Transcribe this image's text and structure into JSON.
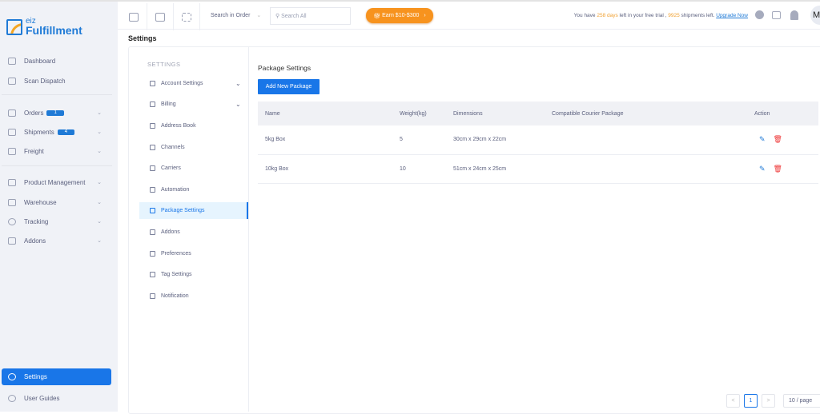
{
  "brand": {
    "small": "eiz",
    "name": "Fulfillment"
  },
  "sidebar": {
    "items": [
      {
        "label": "Dashboard"
      },
      {
        "label": "Scan Dispatch"
      },
      {
        "label": "Orders",
        "badge": "1"
      },
      {
        "label": "Shipments",
        "badge": "4"
      },
      {
        "label": "Freight"
      },
      {
        "label": "Product Management"
      },
      {
        "label": "Warehouse"
      },
      {
        "label": "Tracking"
      },
      {
        "label": "Addons"
      },
      {
        "label": "Settings"
      },
      {
        "label": "User Guides"
      }
    ]
  },
  "topbar": {
    "search_scope": "Search in Order",
    "search_placeholder": "Search All",
    "earn_label": "Earn $10-$300",
    "trial": {
      "prefix": "You have ",
      "days": "258 days",
      "mid": " left in your free trial , ",
      "shipments": "9925",
      "suffix": " shipments left. ",
      "upgrade": "Upgrade Now"
    },
    "avatar": "M"
  },
  "page_title": "Settings",
  "settings_nav": {
    "heading": "SETTINGS",
    "items": [
      "Account Settings",
      "Billing",
      "Address Book",
      "Channels",
      "Carriers",
      "Automation",
      "Package Settings",
      "Addons",
      "Preferences",
      "Tag Settings",
      "Notification"
    ],
    "active": "Package Settings"
  },
  "main": {
    "title": "Package Settings",
    "add_button": "Add New Package",
    "columns": [
      "Name",
      "Weight(kg)",
      "Dimensions",
      "Compatible Courier Package",
      "Action"
    ],
    "rows": [
      {
        "name": "5kg Box",
        "weight": "5",
        "dimensions": "30cm x 29cm x 22cm",
        "courier": ""
      },
      {
        "name": "10kg Box",
        "weight": "10",
        "dimensions": "51cm x 24cm x 25cm",
        "courier": ""
      }
    ]
  },
  "pagination": {
    "prev": "<",
    "page": "1",
    "next": ">",
    "page_size": "10 / page"
  },
  "colors": {
    "primary": "#1976e8",
    "accent": "#f7931e",
    "danger": "#e33333"
  }
}
